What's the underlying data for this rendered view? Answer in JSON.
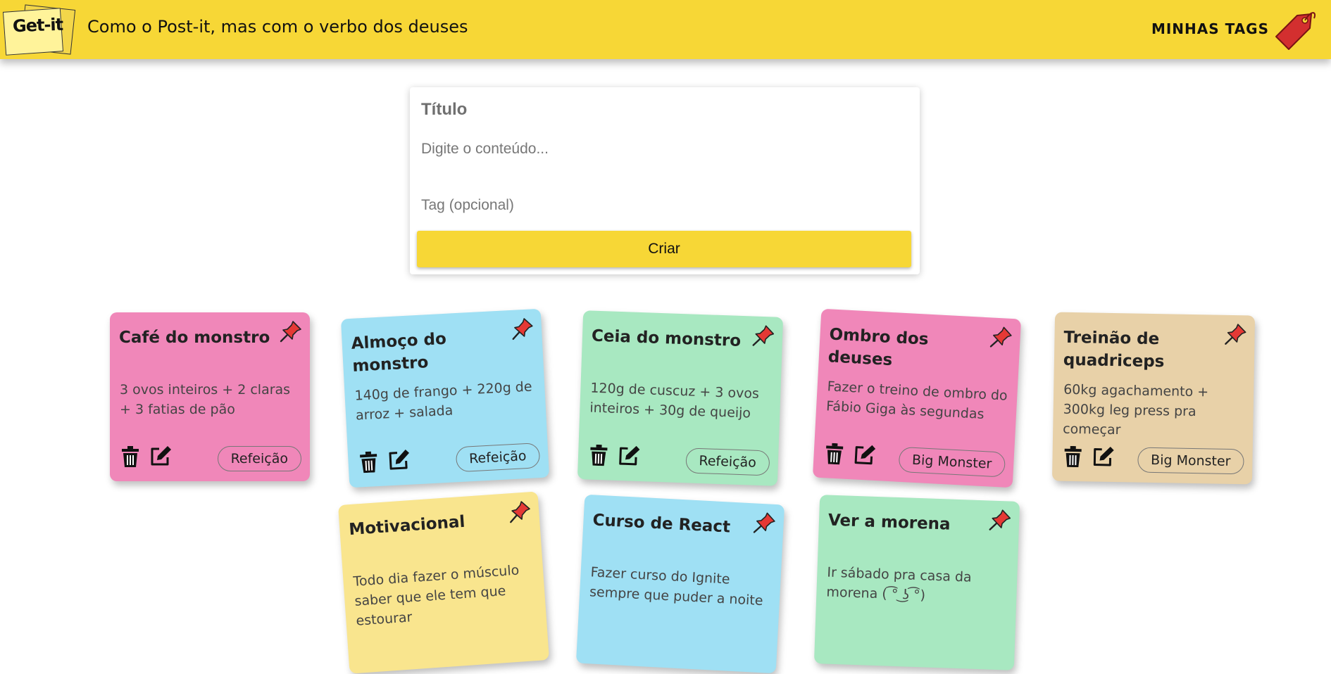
{
  "header": {
    "logo_text": "Get-it",
    "tagline": "Como o Post-it, mas com o verbo dos deuses",
    "tags_link": "MINHAS TAGS",
    "background": "#f7d736"
  },
  "form": {
    "title_placeholder": "Título",
    "content_placeholder": "Digite o conteúdo...",
    "tag_placeholder": "Tag (opcional)",
    "submit_label": "Criar"
  },
  "notes": [
    {
      "title": "Café do monstro",
      "body": "3 ovos inteiros + 2 claras + 3 fatias de pão",
      "tag": "Refeição",
      "color": "pink"
    },
    {
      "title": "Almoço do monstro",
      "body": "140g de frango + 220g de arroz + salada",
      "tag": "Refeição",
      "color": "blue"
    },
    {
      "title": "Ceia do monstro",
      "body": "120g de cuscuz + 3 ovos inteiros + 30g de queijo",
      "tag": "Refeição",
      "color": "green"
    },
    {
      "title": "Ombro dos deuses",
      "body": "Fazer o treino de ombro do Fábio Giga às segundas",
      "tag": "Big Monster",
      "color": "pink"
    },
    {
      "title": "Treinão de quadriceps",
      "body": "60kg agachamento + 300kg leg press pra começar",
      "tag": "Big Monster",
      "color": "tan"
    },
    {
      "title": "Motivacional",
      "body": "Todo dia fazer o músculo saber que ele tem que estourar",
      "tag": "",
      "color": "yellow"
    },
    {
      "title": "Curso de React",
      "body": "Fazer curso do Ignite sempre que puder a noite",
      "tag": "",
      "color": "blue"
    },
    {
      "title": "Ver a morena",
      "body": "Ir sábado pra casa da morena ( ͡° ͜ʖ ͡°)",
      "tag": "",
      "color": "green"
    }
  ],
  "colors": {
    "pink": "#f087b9",
    "blue": "#9fe0f4",
    "green": "#a8e8c1",
    "tan": "#e8d1a8",
    "yellow": "#f9e58e",
    "pin": "#e53935",
    "tag_icon": "#d32f2f"
  },
  "icons": [
    "tag-icon",
    "pin-icon",
    "trash-icon",
    "edit-icon"
  ]
}
